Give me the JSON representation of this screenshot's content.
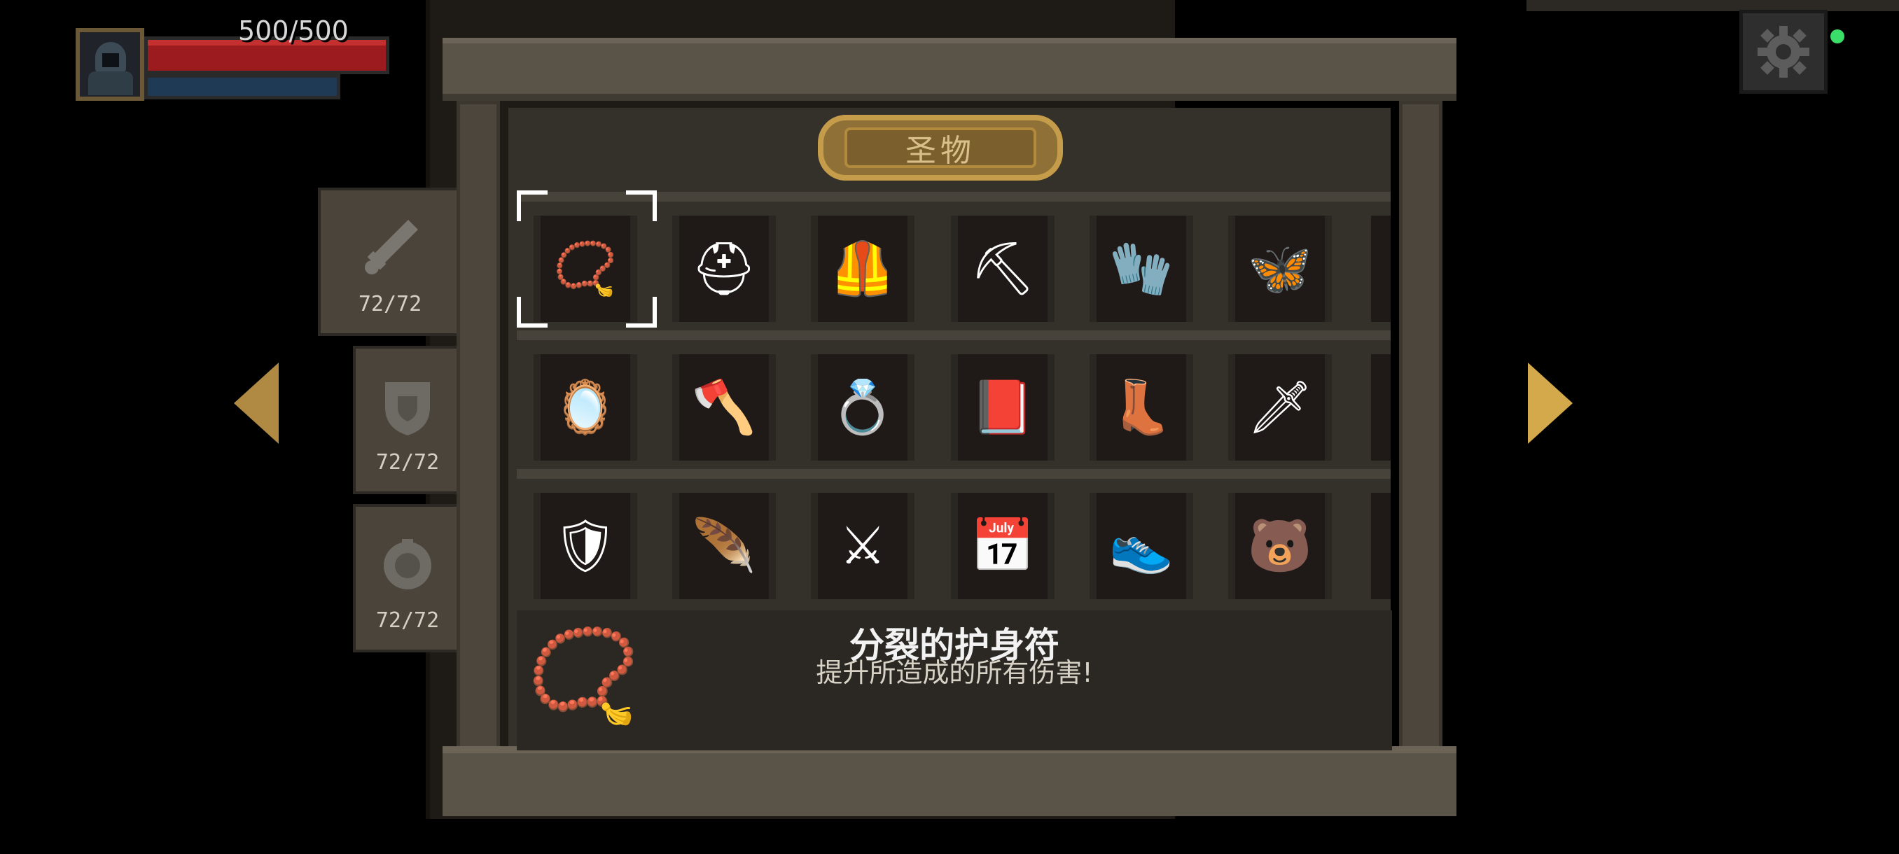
{
  "hud": {
    "hp_text": "500/500",
    "hp_fraction": 1.0,
    "mp_fraction": 1.0
  },
  "icons": {
    "settings": "gear-icon",
    "left": "arrow-left-icon",
    "right": "arrow-right-icon"
  },
  "categories": [
    {
      "icon": "sword-icon",
      "count": "72/72"
    },
    {
      "icon": "shield-icon",
      "count": "72/72"
    },
    {
      "icon": "orb-icon",
      "count": "72/72"
    }
  ],
  "relics_panel": {
    "title": "圣物",
    "rows": [
      [
        {
          "name": "amulet",
          "glyph": "📿"
        },
        {
          "name": "horned-helmet",
          "glyph": "⛑"
        },
        {
          "name": "pauldron",
          "glyph": "🦺"
        },
        {
          "name": "shovel",
          "glyph": "⛏"
        },
        {
          "name": "purple-gauntlet",
          "glyph": "🧤"
        },
        {
          "name": "wings",
          "glyph": "🦋"
        }
      ],
      [
        {
          "name": "hand-mirror",
          "glyph": "🪞"
        },
        {
          "name": "battle-axe",
          "glyph": "🪓"
        },
        {
          "name": "ring",
          "glyph": "💍"
        },
        {
          "name": "black-book",
          "glyph": "📕"
        },
        {
          "name": "purple-boot",
          "glyph": "👢"
        },
        {
          "name": "dagger",
          "glyph": "🗡"
        }
      ],
      [
        {
          "name": "gold-armor",
          "glyph": "🛡"
        },
        {
          "name": "feather",
          "glyph": "🪶"
        },
        {
          "name": "golden-sword",
          "glyph": "⚔"
        },
        {
          "name": "calendar",
          "glyph": "📅"
        },
        {
          "name": "red-shoe",
          "glyph": "👟"
        },
        {
          "name": "bear-head",
          "glyph": "🐻"
        }
      ]
    ]
  },
  "selected": {
    "name": "分裂的护身符",
    "description": "提升所造成的所有伤害!",
    "glyph": "📿"
  },
  "colors": {
    "hp": "#9b1b1e",
    "accent_gold": "#c59d4a",
    "online": "#3adf6a"
  }
}
